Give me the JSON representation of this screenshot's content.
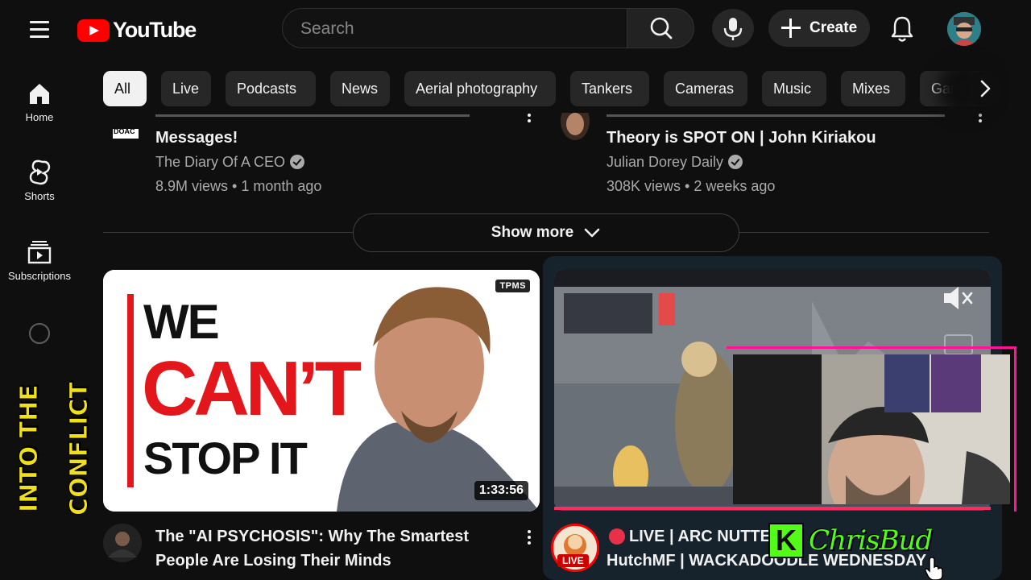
{
  "header": {
    "logo_text": "YouTube",
    "search_placeholder": "Search",
    "create_label": "Create"
  },
  "chips": [
    "All",
    "Live",
    "Podcasts",
    "News",
    "Aerial photography",
    "Tankers",
    "Cameras",
    "Music",
    "Mixes",
    "Gami"
  ],
  "sidebar": {
    "items": [
      {
        "label": "Home",
        "icon": "home-icon"
      },
      {
        "label": "Shorts",
        "icon": "shorts-icon"
      },
      {
        "label": "Subscriptions",
        "icon": "subscriptions-icon"
      }
    ]
  },
  "feed": {
    "top_left": {
      "title_partial": "Messages!",
      "channel": "The Diary Of A CEO",
      "channel_badge": "DOAC",
      "stats": "8.9M views • 1 month ago"
    },
    "top_right": {
      "title_partial": "Theory is SPOT ON | John Kiriakou",
      "channel": "Julian Dorey Daily",
      "stats": "308K views • 2 weeks ago"
    },
    "show_more_label": "Show more",
    "video1": {
      "thumb_line1": "WE",
      "thumb_line2": "CAN’T",
      "thumb_line3": "STOP IT",
      "thumb_badge": "TPMS",
      "duration": "1:33:56",
      "title_line1": "The \"AI PSYCHOSIS\": Why The Smartest",
      "title_line2": "People Are Losing Their Minds"
    },
    "video2": {
      "live_badge": "LIVE",
      "title_line1": "LIVE | ARC NUTTE",
      "title_line2": "HutchMF | WACKADOODLE WEDNESDAY"
    }
  },
  "overlays": {
    "brand_letter": "K",
    "brand_name": "ChrisBud",
    "side_banner": "INTO THE CONFLICT"
  },
  "colors": {
    "background": "#0f0f0f",
    "youtube_red": "#ff0000",
    "live_progress": "#ff2b5e",
    "kick_green": "#53fc18"
  }
}
